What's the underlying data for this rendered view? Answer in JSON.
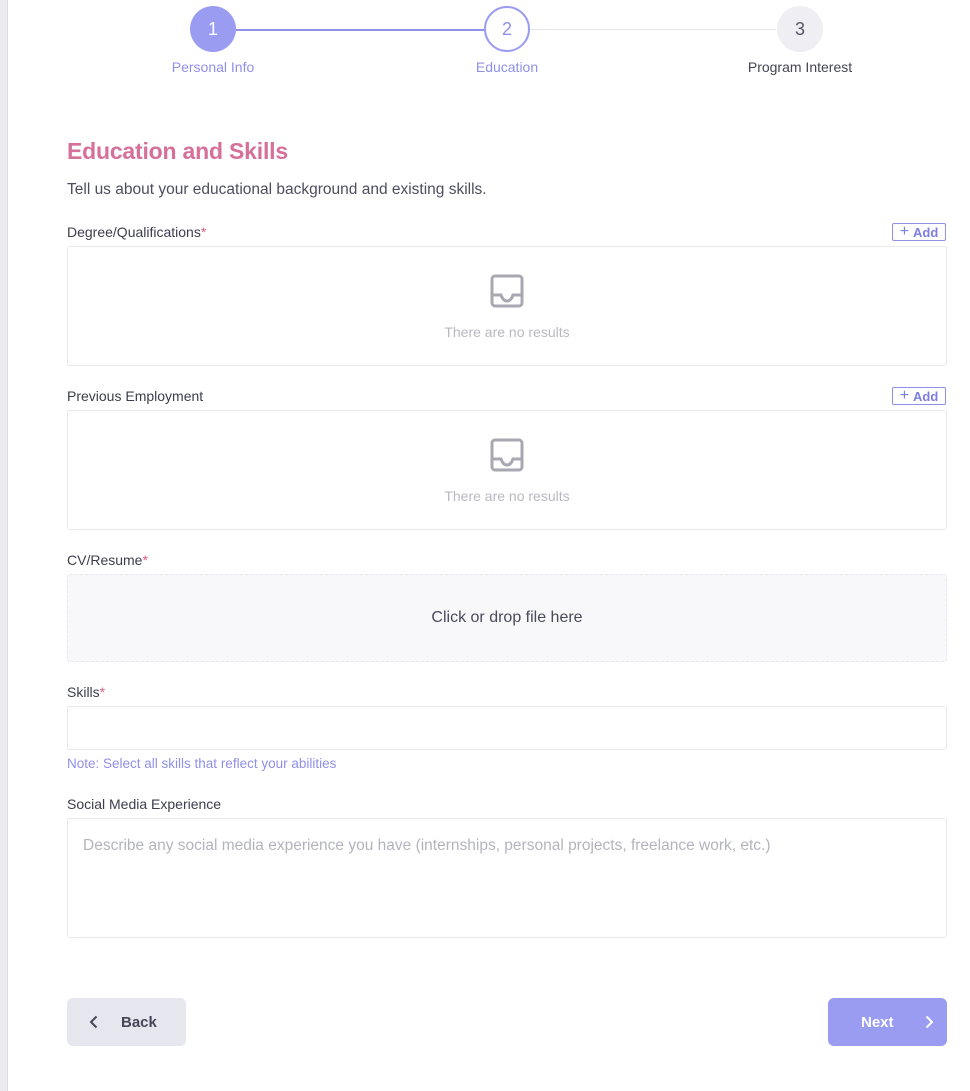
{
  "stepper": {
    "steps": [
      {
        "number": "1",
        "label": "Personal Info"
      },
      {
        "number": "2",
        "label": "Education"
      },
      {
        "number": "3",
        "label": "Program Interest"
      }
    ]
  },
  "form": {
    "title": "Education and Skills",
    "subtitle": "Tell us about your educational background and existing skills.",
    "required_mark": "*",
    "degree": {
      "label": "Degree/Qualifications",
      "add_label": "Add",
      "empty_text": "There are no results"
    },
    "employment": {
      "label": "Previous Employment",
      "add_label": "Add",
      "empty_text": "There are no results"
    },
    "cv": {
      "label": "CV/Resume",
      "dropzone_text": "Click or drop file here"
    },
    "skills": {
      "label": "Skills",
      "value": "",
      "note": "Note: Select all skills that reflect your abilities"
    },
    "social": {
      "label": "Social Media Experience",
      "placeholder": "Describe any social media experience you have (internships, personal projects, freelance work, etc.)"
    }
  },
  "buttons": {
    "back": "Back",
    "next": "Next"
  },
  "colors": {
    "accent": "#9a9cf2",
    "title": "#d4709a",
    "required": "#e05a7e"
  },
  "icons": [
    "inbox-icon",
    "plus-icon",
    "chevron-left-icon",
    "chevron-right-icon"
  ]
}
